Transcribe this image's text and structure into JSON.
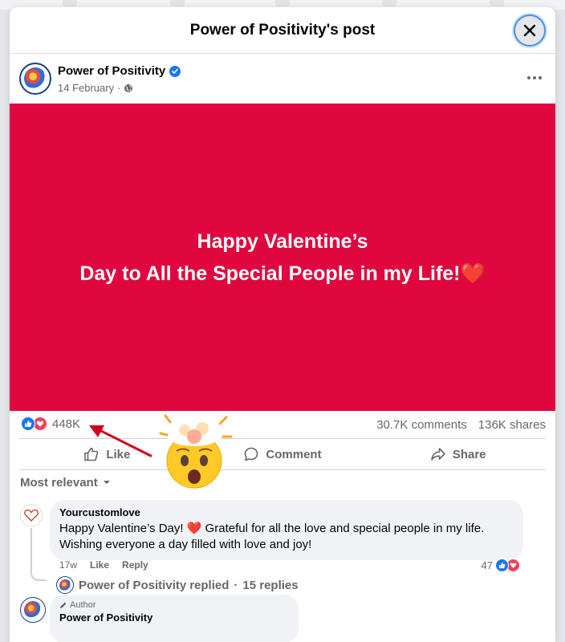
{
  "modal": {
    "title": "Power of Positivity's post"
  },
  "post": {
    "author": "Power of Positivity",
    "date": "14 February",
    "date_separator": "·",
    "image_line1": "Happy Valentine’s",
    "image_line2": "Day to All the Special People in my Life!",
    "image_emoji": "❤️",
    "image_bg": "#e0073e"
  },
  "stats": {
    "reaction_count": "448K",
    "comments": "30.7K comments",
    "shares": "136K shares"
  },
  "actions": {
    "like": "Like",
    "comment": "Comment",
    "share": "Share"
  },
  "sort": {
    "label": "Most relevant"
  },
  "comment1": {
    "author": "Yourcustomlove",
    "text_part1": "Happy Valentine’s Day! ",
    "emoji": "❤️",
    "text_part2": " Grateful for all the love and special people in my life. Wishing everyone a day filled with love and joy!",
    "time": "17w",
    "like": "Like",
    "reply": "Reply",
    "reaction_count": "47",
    "replied_author": "Power of Positivity",
    "replied_text": "replied",
    "replies_sep": "·",
    "replies_count": "15 replies"
  },
  "comment2": {
    "badge": "Author",
    "author": "Power of Positivity"
  },
  "annotation": {
    "emoji": "🤯",
    "arrow_color": "#d0021b"
  }
}
